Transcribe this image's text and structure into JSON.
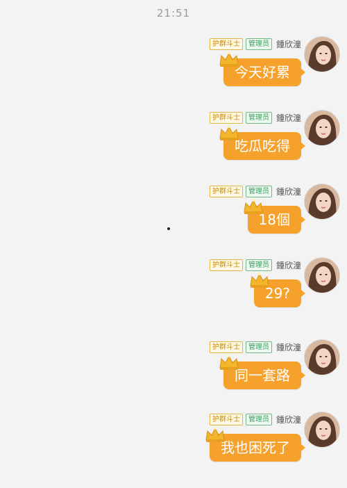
{
  "status": {
    "time": "21:51"
  },
  "sender": {
    "name": "鍾欣潼",
    "tag_admin": "管理员",
    "tag_guard": "护群斗士"
  },
  "messages": [
    {
      "text": "今天好累"
    },
    {
      "text": "吃瓜吃得"
    },
    {
      "text": "18個"
    },
    {
      "text": "29?"
    },
    {
      "text": "同一套路"
    },
    {
      "text": "我也困死了"
    }
  ],
  "colors": {
    "bubble": "#f6a12c",
    "background": "#f3f3f3",
    "crown": "#f2b52b"
  },
  "icons": {
    "crown": "crown-icon",
    "avatar": "avatar"
  }
}
